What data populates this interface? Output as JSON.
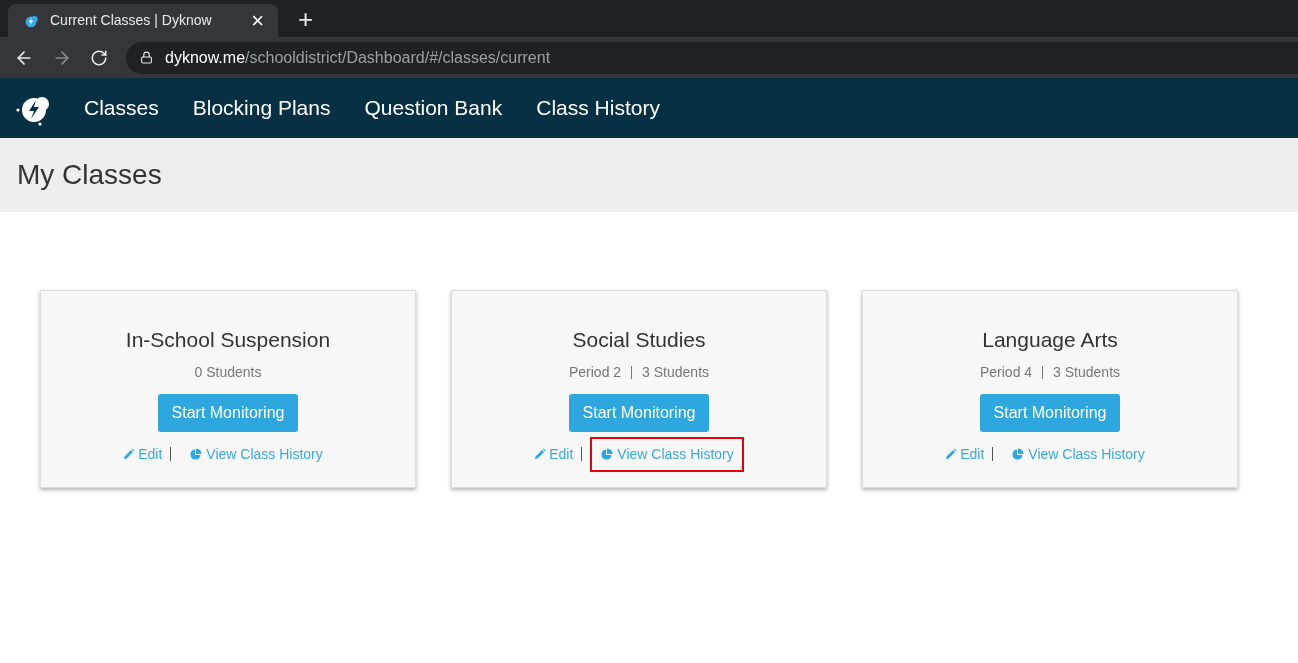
{
  "browser": {
    "tab_title": "Current Classes | Dyknow",
    "tab_close": "×",
    "new_tab": "+",
    "url": {
      "host": "dyknow.me",
      "path": "/schooldistrict/Dashboard/#/classes/current"
    }
  },
  "nav": {
    "items": [
      {
        "label": "Classes"
      },
      {
        "label": "Blocking Plans"
      },
      {
        "label": "Question Bank"
      },
      {
        "label": "Class History"
      }
    ]
  },
  "page_title": "My Classes",
  "classes": [
    {
      "name": "In-School Suspension",
      "details": [
        "0 Students"
      ],
      "button": "Start Monitoring",
      "edit": "Edit",
      "history": "View Class History",
      "highlighted": false
    },
    {
      "name": "Social Studies",
      "details": [
        "Period 2",
        "3 Students"
      ],
      "button": "Start Monitoring",
      "edit": "Edit",
      "history": "View Class History",
      "highlighted": true
    },
    {
      "name": "Language Arts",
      "details": [
        "Period 4",
        "3 Students"
      ],
      "button": "Start Monitoring",
      "edit": "Edit",
      "history": "View Class History",
      "highlighted": false
    }
  ]
}
